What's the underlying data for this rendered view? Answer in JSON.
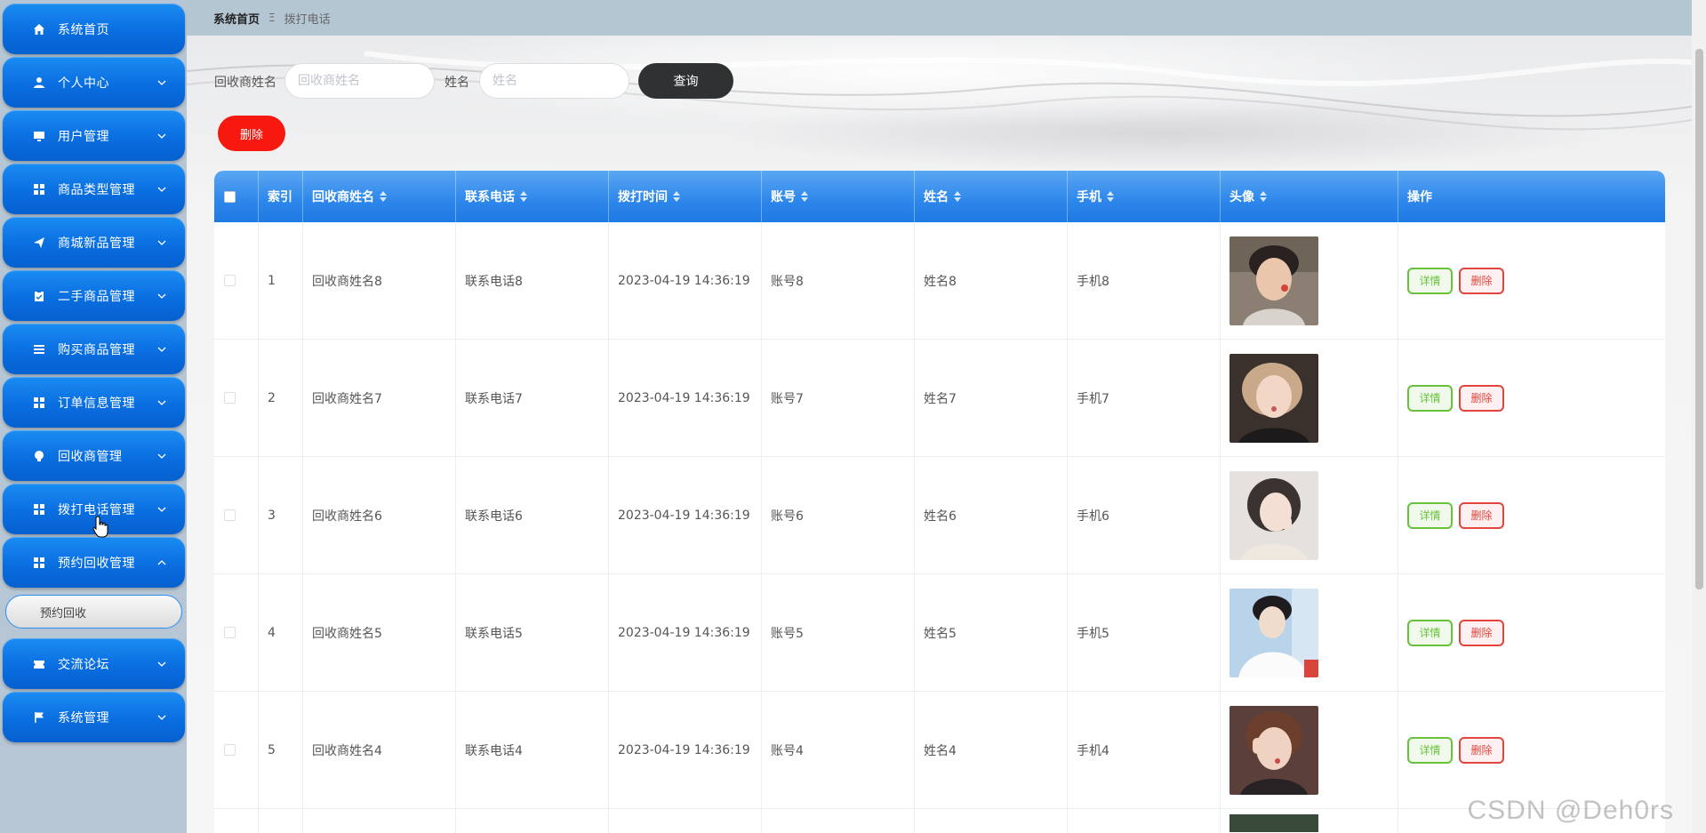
{
  "sidebar": {
    "items": [
      {
        "label": "系统首页",
        "icon": "home-icon",
        "expandable": false
      },
      {
        "label": "个人中心",
        "icon": "user-icon",
        "expandable": true
      },
      {
        "label": "用户管理",
        "icon": "monitor-icon",
        "expandable": true
      },
      {
        "label": "商品类型管理",
        "icon": "grid-icon",
        "expandable": true
      },
      {
        "label": "商城新品管理",
        "icon": "send-icon",
        "expandable": true
      },
      {
        "label": "二手商品管理",
        "icon": "clipboard-icon",
        "expandable": true
      },
      {
        "label": "购买商品管理",
        "icon": "list-icon",
        "expandable": true
      },
      {
        "label": "订单信息管理",
        "icon": "grid-icon",
        "expandable": true
      },
      {
        "label": "回收商管理",
        "icon": "bulb-icon",
        "expandable": true
      },
      {
        "label": "拨打电话管理",
        "icon": "grid-icon",
        "expandable": true
      },
      {
        "label": "预约回收管理",
        "icon": "grid-icon",
        "expandable": true,
        "expanded": true
      },
      {
        "label": "交流论坛",
        "icon": "ticket-icon",
        "expandable": true
      },
      {
        "label": "系统管理",
        "icon": "flag-icon",
        "expandable": true
      }
    ],
    "sub_item": "预约回收"
  },
  "breadcrumb": {
    "home": "系统首页",
    "separator": "Ξ",
    "current": "拨打电话"
  },
  "search": {
    "recycler_label": "回收商姓名",
    "recycler_placeholder": "回收商姓名",
    "name_label": "姓名",
    "name_placeholder": "姓名",
    "query_button": "查询"
  },
  "actions": {
    "delete_button": "删除"
  },
  "table": {
    "columns": [
      "索引",
      "回收商姓名",
      "联系电话",
      "拨打时间",
      "账号",
      "姓名",
      "手机",
      "头像",
      "操作"
    ],
    "rows": [
      {
        "index": "1",
        "recycler": "回收商姓名8",
        "phone": "联系电话8",
        "time": "2023-04-19 14:36:19",
        "account": "账号8",
        "name": "姓名8",
        "mobile": "手机8"
      },
      {
        "index": "2",
        "recycler": "回收商姓名7",
        "phone": "联系电话7",
        "time": "2023-04-19 14:36:19",
        "account": "账号7",
        "name": "姓名7",
        "mobile": "手机7"
      },
      {
        "index": "3",
        "recycler": "回收商姓名6",
        "phone": "联系电话6",
        "time": "2023-04-19 14:36:19",
        "account": "账号6",
        "name": "姓名6",
        "mobile": "手机6"
      },
      {
        "index": "4",
        "recycler": "回收商姓名5",
        "phone": "联系电话5",
        "time": "2023-04-19 14:36:19",
        "account": "账号5",
        "name": "姓名5",
        "mobile": "手机5"
      },
      {
        "index": "5",
        "recycler": "回收商姓名4",
        "phone": "联系电话4",
        "time": "2023-04-19 14:36:19",
        "account": "账号4",
        "name": "姓名4",
        "mobile": "手机4"
      }
    ],
    "detail_button": "详情",
    "remove_button": "删除"
  },
  "watermark": "CSDN @Deh0rs",
  "colors": {
    "sidebar_blue": "#0a6ee0",
    "header_blue": "#2d86ea",
    "delete_red": "#f7190f",
    "query_dark": "#303133"
  }
}
